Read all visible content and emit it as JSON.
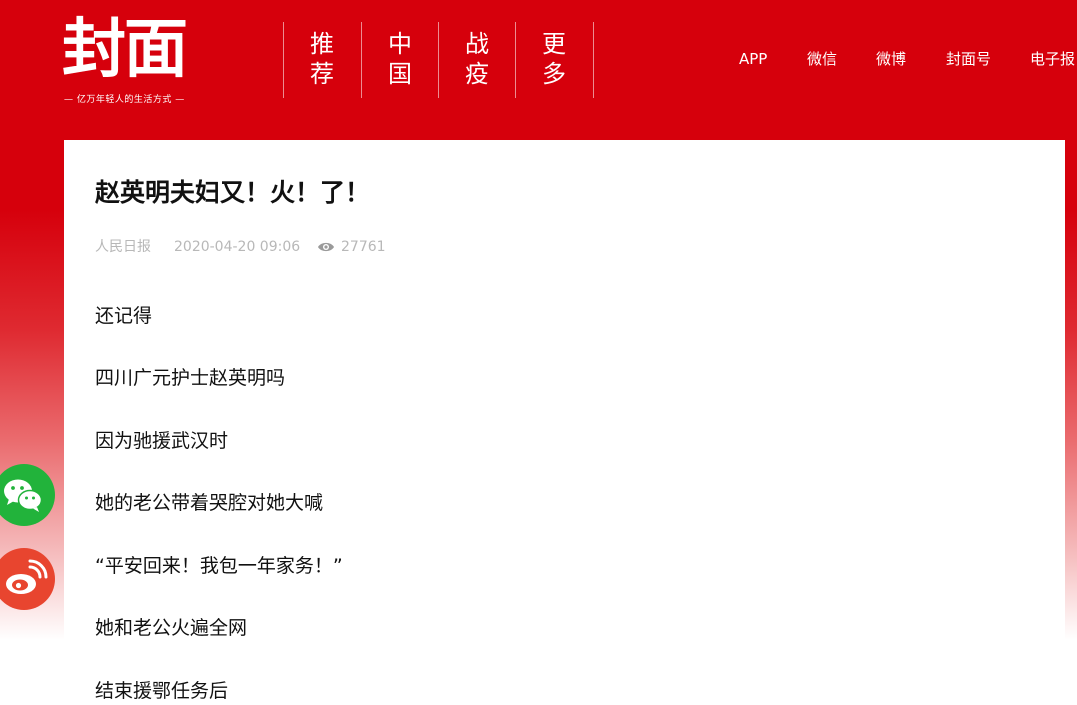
{
  "header": {
    "logo_text": "封面",
    "slogan": "— 亿万年轻人的生活方式 —",
    "nav": [
      {
        "top": "推",
        "bottom": "荐"
      },
      {
        "top": "中",
        "bottom": "国"
      },
      {
        "top": "战",
        "bottom": "疫"
      },
      {
        "top": "更",
        "bottom": "多"
      }
    ],
    "links": [
      "APP",
      "微信",
      "微博",
      "封面号",
      "电子报"
    ]
  },
  "article": {
    "title": "赵英明夫妇又！火！了！",
    "source": "人民日报",
    "datetime": "2020-04-20 09:06",
    "views": "27761",
    "paragraphs": [
      "还记得",
      "四川广元护士赵英明吗",
      "因为驰援武汉时",
      "她的老公带着哭腔对她大喊",
      "“平安回来！我包一年家务！”",
      "她和老公火遍全网",
      "结束援鄂任务后"
    ]
  },
  "share": {
    "wechat_icon": "wechat-icon",
    "weibo_icon": "weibo-icon"
  },
  "colors": {
    "brand_red": "#d6000c",
    "wechat_green": "#22b33b",
    "weibo_red": "#e8452f",
    "meta_gray": "#b8b8b8"
  }
}
